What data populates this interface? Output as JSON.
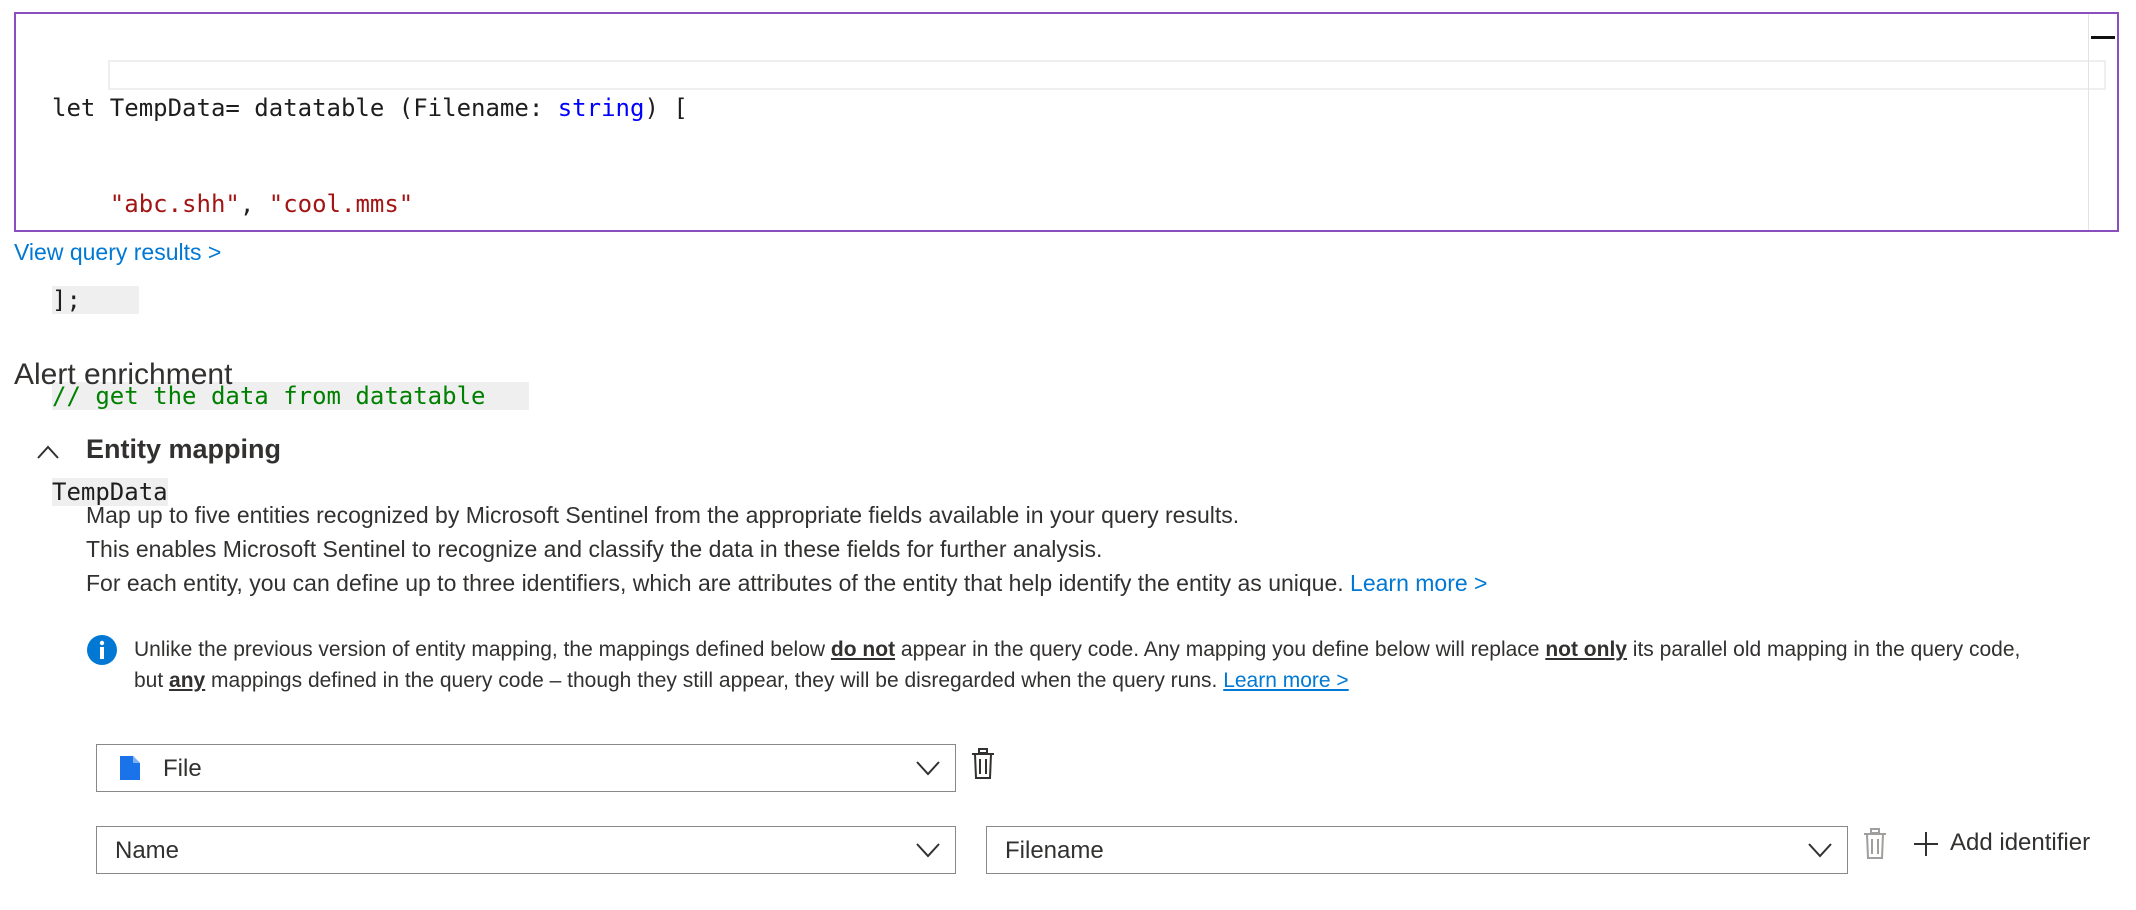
{
  "editor": {
    "line1": {
      "a": "let TempData= datatable (Filename: ",
      "kw": "string",
      "b": ") ["
    },
    "line2": {
      "indent": "    ",
      "s1": "\"abc.shh\"",
      "sep": ", ",
      "s2": "\"cool.mms\""
    },
    "line3": "];",
    "line4": "// get the data from datatable",
    "line5": "TempData"
  },
  "view_results_link": "View query results >",
  "alert_enrichment_title": "Alert enrichment",
  "entity_mapping": {
    "title": "Entity mapping",
    "desc_line1": "Map up to five entities recognized by Microsoft Sentinel from the appropriate fields available in your query results.",
    "desc_line2": "This enables Microsoft Sentinel to recognize and classify the data in these fields for further analysis.",
    "desc_line3": "For each entity, you can define up to three identifiers, which are attributes of the entity that help identify the entity as unique.",
    "learn_more": "Learn more >",
    "info": {
      "t1": "Unlike the previous version of entity mapping, the mappings defined below ",
      "b1": "do not",
      "t2": " appear in the query code. Any mapping you define below will replace ",
      "b2": "not only",
      "t3": " its parallel old mapping in the query code, but ",
      "b3": "any",
      "t4": " mappings defined in the query code – though they still appear, they will be disregarded when the query runs. ",
      "link": "Learn more >"
    },
    "entity_type": "File",
    "identifier": "Name",
    "column": "Filename",
    "add_identifier": "Add identifier"
  },
  "colors": {
    "accent": "#0078d4",
    "editor_border": "#8a4ebf",
    "keyword": "#0000ff",
    "string": "#a31515",
    "comment": "#008000"
  },
  "icons": [
    "info-icon",
    "chevron-up-icon",
    "file-icon",
    "chevron-down-icon",
    "trash-icon",
    "plus-icon"
  ]
}
